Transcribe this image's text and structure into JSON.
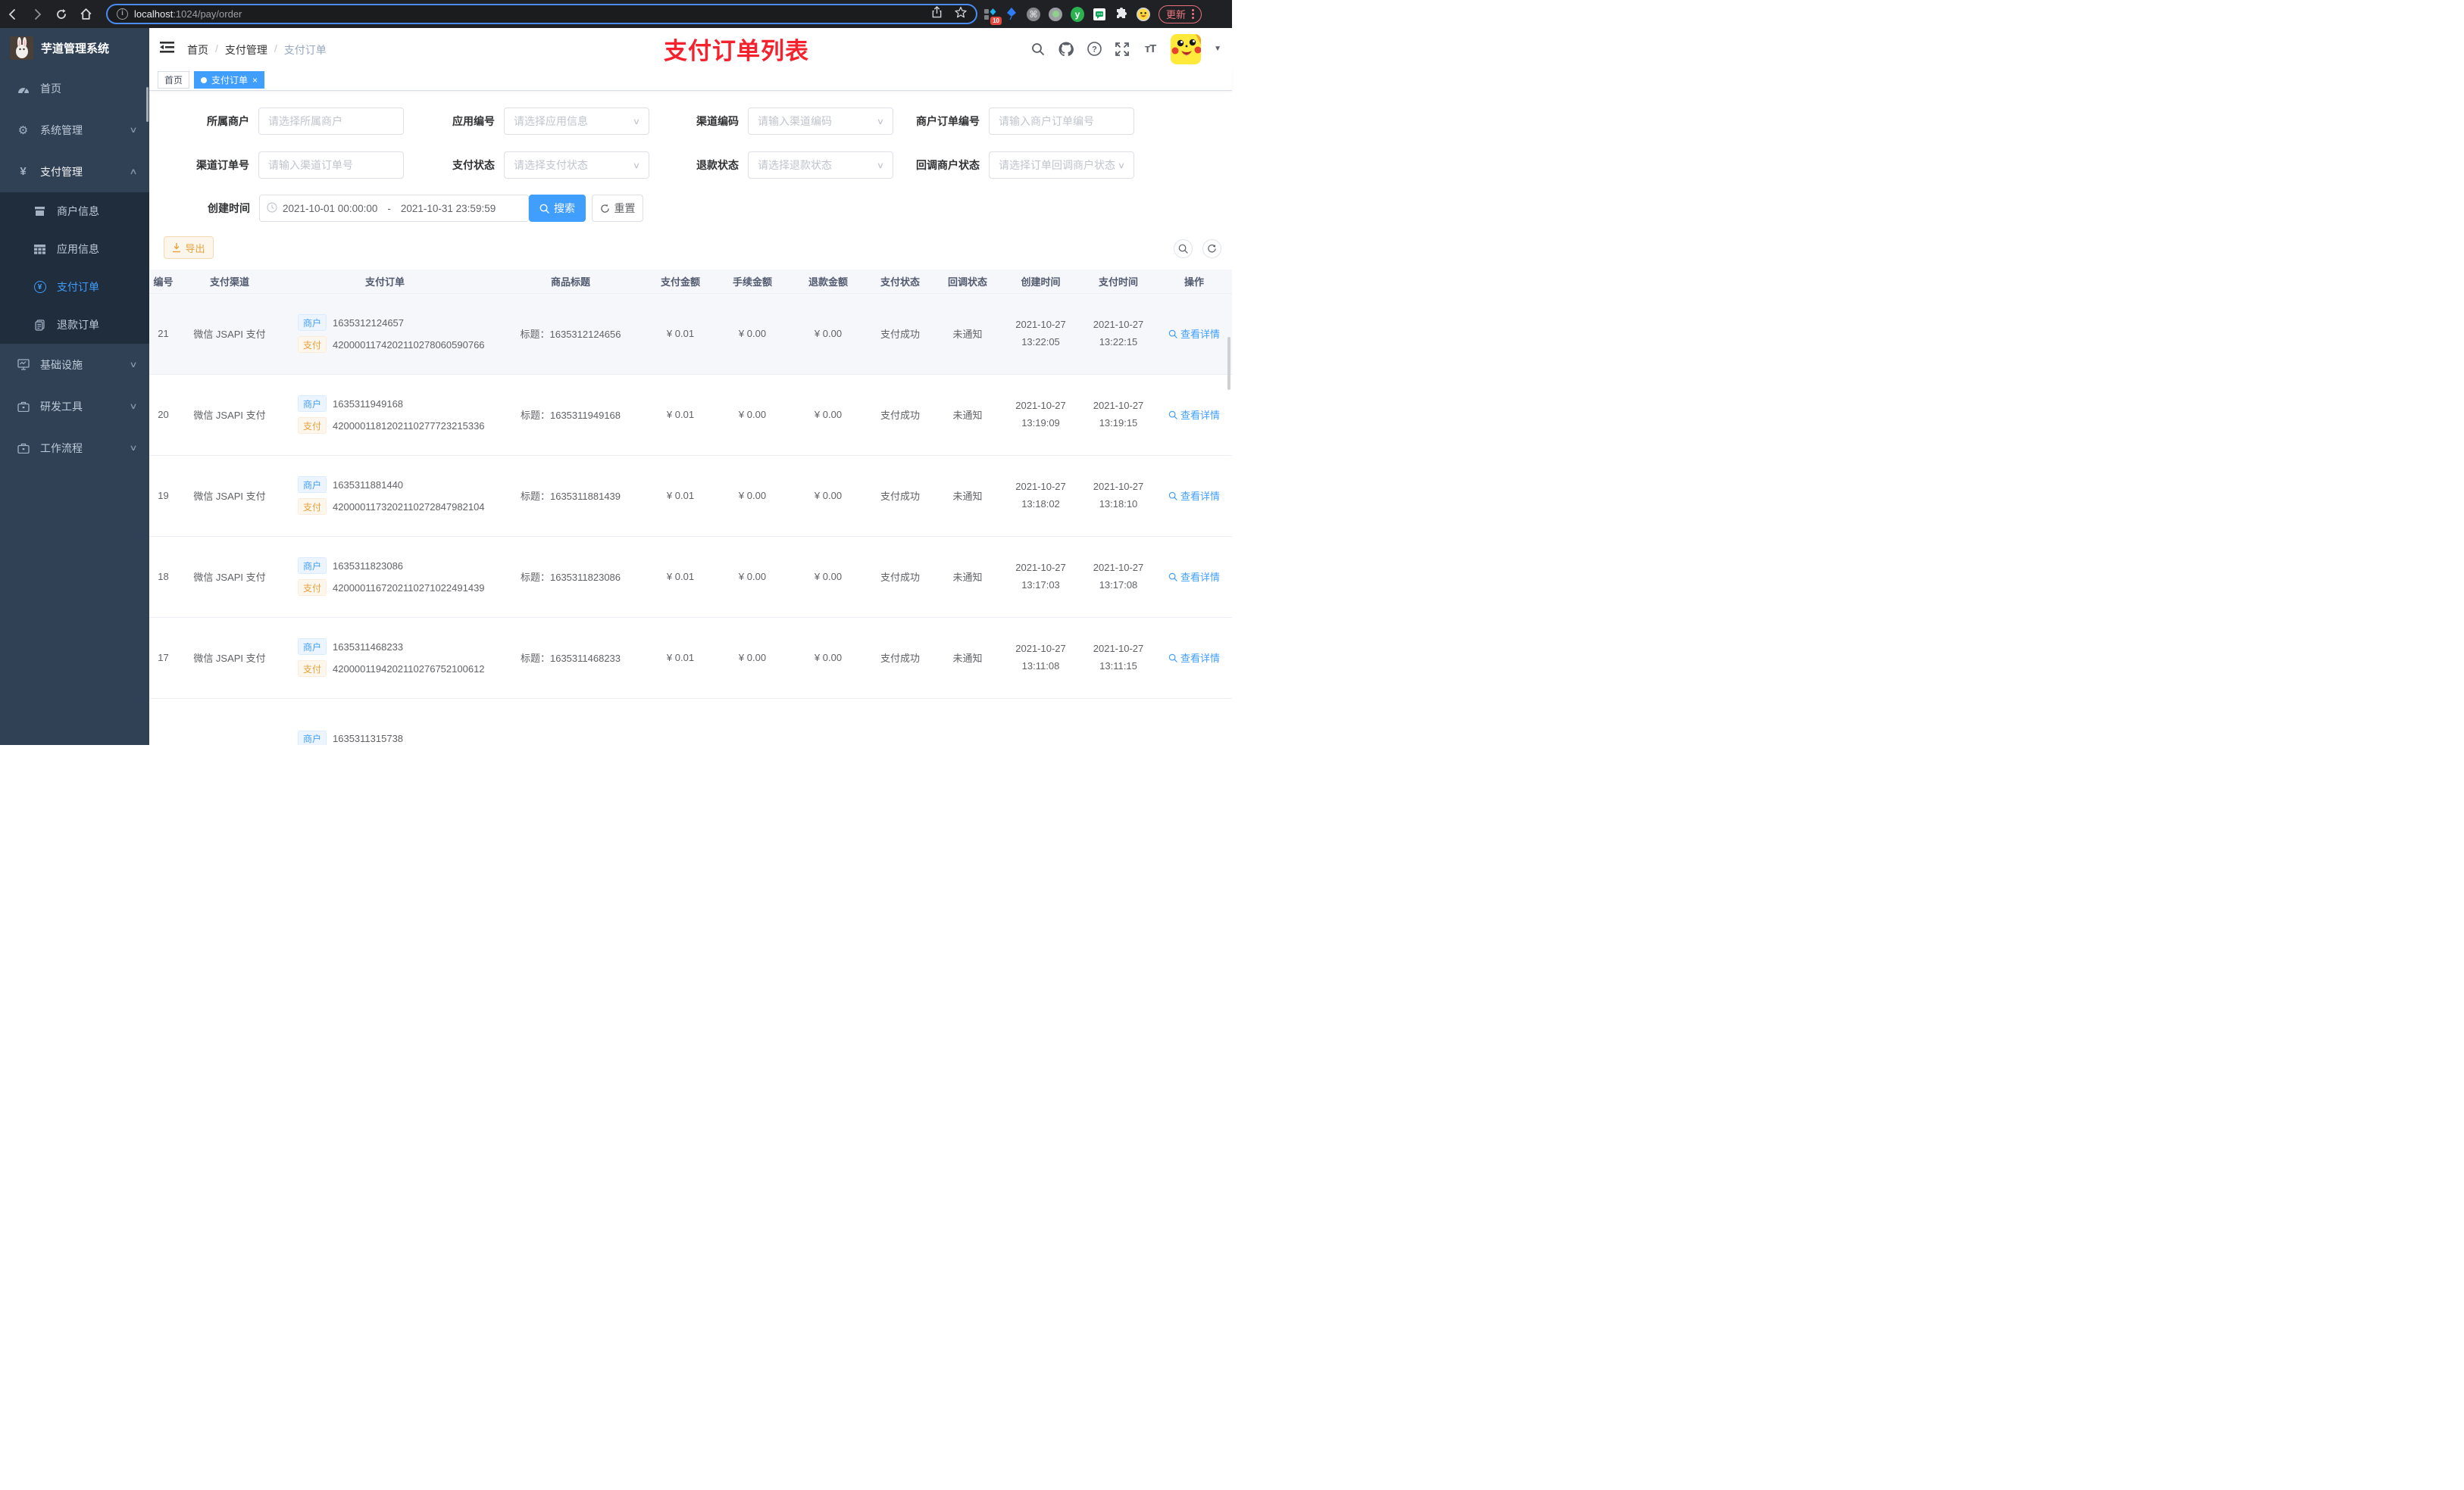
{
  "browser": {
    "url_host": "localhost",
    "url_rest": ":1024/pay/order",
    "badge_count": "10",
    "update_label": "更新"
  },
  "sidebar": {
    "logo_title": "芋道管理系统",
    "menu": [
      {
        "label": "首页"
      },
      {
        "label": "系统管理"
      },
      {
        "label": "支付管理",
        "children": [
          {
            "label": "商户信息"
          },
          {
            "label": "应用信息"
          },
          {
            "label": "支付订单"
          },
          {
            "label": "退款订单"
          }
        ]
      },
      {
        "label": "基础设施"
      },
      {
        "label": "研发工具"
      },
      {
        "label": "工作流程"
      }
    ]
  },
  "header": {
    "breadcrumb": [
      "首页",
      "支付管理",
      "支付订单"
    ],
    "annotation": "支付订单列表"
  },
  "tabs": [
    {
      "label": "首页"
    },
    {
      "label": "支付订单"
    }
  ],
  "filters": {
    "row1": [
      {
        "label": "所属商户",
        "placeholder": "请选择所属商户",
        "type": "input"
      },
      {
        "label": "应用编号",
        "placeholder": "请选择应用信息",
        "type": "select"
      },
      {
        "label": "渠道编码",
        "placeholder": "请输入渠道编码",
        "type": "select"
      },
      {
        "label": "商户订单编号",
        "placeholder": "请输入商户订单编号",
        "type": "input"
      }
    ],
    "row2": [
      {
        "label": "渠道订单号",
        "placeholder": "请输入渠道订单号",
        "type": "input"
      },
      {
        "label": "支付状态",
        "placeholder": "请选择支付状态",
        "type": "select"
      },
      {
        "label": "退款状态",
        "placeholder": "请选择退款状态",
        "type": "select"
      },
      {
        "label": "回调商户状态",
        "placeholder": "请选择订单回调商户状态",
        "type": "select"
      }
    ],
    "date": {
      "label": "创建时间",
      "start": "2021-10-01 00:00:00",
      "separator": "-",
      "end": "2021-10-31 23:59:59"
    },
    "search_label": "搜索",
    "reset_label": "重置",
    "export_label": "导出"
  },
  "table": {
    "headers": [
      "编号",
      "支付渠道",
      "支付订单",
      "商品标题",
      "支付金额",
      "手续金额",
      "退款金额",
      "支付状态",
      "回调状态",
      "创建时间",
      "支付时间",
      "操作"
    ],
    "merchant_tag": "商户",
    "pay_tag": "支付",
    "action_label": "查看详情",
    "rows": [
      {
        "id": "21",
        "channel": "微信 JSAPI 支付",
        "merchant_no": "1635312124657",
        "pay_no": "4200001174202110278060590766",
        "title": "标题：1635312124656",
        "amount": "¥ 0.01",
        "fee": "¥ 0.00",
        "refund": "¥ 0.00",
        "status": "支付成功",
        "notify": "未通知",
        "create_date": "2021-10-27",
        "create_time": "13:22:05",
        "pay_date": "2021-10-27",
        "pay_time": "13:22:15",
        "hovered": true
      },
      {
        "id": "20",
        "channel": "微信 JSAPI 支付",
        "merchant_no": "1635311949168",
        "pay_no": "4200001181202110277723215336",
        "title": "标题：1635311949168",
        "amount": "¥ 0.01",
        "fee": "¥ 0.00",
        "refund": "¥ 0.00",
        "status": "支付成功",
        "notify": "未通知",
        "create_date": "2021-10-27",
        "create_time": "13:19:09",
        "pay_date": "2021-10-27",
        "pay_time": "13:19:15",
        "hovered": false
      },
      {
        "id": "19",
        "channel": "微信 JSAPI 支付",
        "merchant_no": "1635311881440",
        "pay_no": "4200001173202110272847982104",
        "title": "标题：1635311881439",
        "amount": "¥ 0.01",
        "fee": "¥ 0.00",
        "refund": "¥ 0.00",
        "status": "支付成功",
        "notify": "未通知",
        "create_date": "2021-10-27",
        "create_time": "13:18:02",
        "pay_date": "2021-10-27",
        "pay_time": "13:18:10",
        "hovered": false
      },
      {
        "id": "18",
        "channel": "微信 JSAPI 支付",
        "merchant_no": "1635311823086",
        "pay_no": "4200001167202110271022491439",
        "title": "标题：1635311823086",
        "amount": "¥ 0.01",
        "fee": "¥ 0.00",
        "refund": "¥ 0.00",
        "status": "支付成功",
        "notify": "未通知",
        "create_date": "2021-10-27",
        "create_time": "13:17:03",
        "pay_date": "2021-10-27",
        "pay_time": "13:17:08",
        "hovered": false
      },
      {
        "id": "17",
        "channel": "微信 JSAPI 支付",
        "merchant_no": "1635311468233",
        "pay_no": "4200001194202110276752100612",
        "title": "标题：1635311468233",
        "amount": "¥ 0.01",
        "fee": "¥ 0.00",
        "refund": "¥ 0.00",
        "status": "支付成功",
        "notify": "未通知",
        "create_date": "2021-10-27",
        "create_time": "13:11:08",
        "pay_date": "2021-10-27",
        "pay_time": "13:11:15",
        "hovered": false
      },
      {
        "id": "",
        "channel": "",
        "merchant_no": "1635311315738",
        "pay_no": "",
        "title": "",
        "amount": "",
        "fee": "",
        "refund": "",
        "status": "",
        "notify": "",
        "create_date": "",
        "create_time": "",
        "pay_date": "",
        "pay_time": "",
        "hovered": false,
        "partial": true
      }
    ]
  },
  "colors": {
    "accent": "#409eff",
    "annotation_red": "#f5222d",
    "warning": "#e6a23c",
    "sidebar_bg": "#304156",
    "submenu_bg": "#1f2d3d"
  }
}
